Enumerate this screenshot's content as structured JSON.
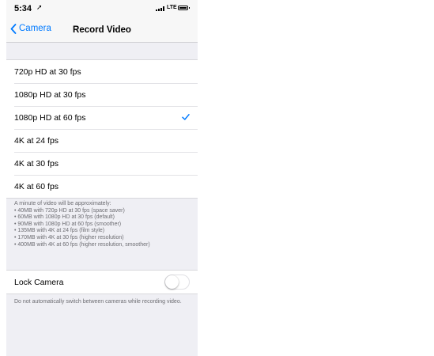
{
  "status_bar": {
    "time": "5:34",
    "location_glyph": "➚",
    "network": "LTE"
  },
  "nav": {
    "back_label": "Camera",
    "title": "Record Video"
  },
  "options": [
    {
      "label": "720p HD at 30 fps",
      "selected": false
    },
    {
      "label": "1080p HD at 30 fps",
      "selected": false
    },
    {
      "label": "1080p HD at 60 fps",
      "selected": true
    },
    {
      "label": "4K at 24 fps",
      "selected": false
    },
    {
      "label": "4K at 30 fps",
      "selected": false
    },
    {
      "label": "4K at 60 fps",
      "selected": false
    }
  ],
  "info": {
    "heading": "A minute of video will be approximately:",
    "lines": [
      "• 40MB with 720p HD at 30 fps (space saver)",
      "• 60MB with 1080p HD at 30 fps (default)",
      "• 90MB with 1080p HD at 60 fps (smoother)",
      "• 135MB with 4K at 24 fps (film style)",
      "• 170MB with 4K at 30 fps (higher resolution)",
      "• 400MB with 4K at 60 fps (higher resolution, smoother)"
    ]
  },
  "lock_camera": {
    "label": "Lock Camera",
    "enabled": false,
    "footer": "Do not automatically switch between cameras while recording video."
  },
  "colors": {
    "accent": "#007aff",
    "background": "#efeff4"
  }
}
